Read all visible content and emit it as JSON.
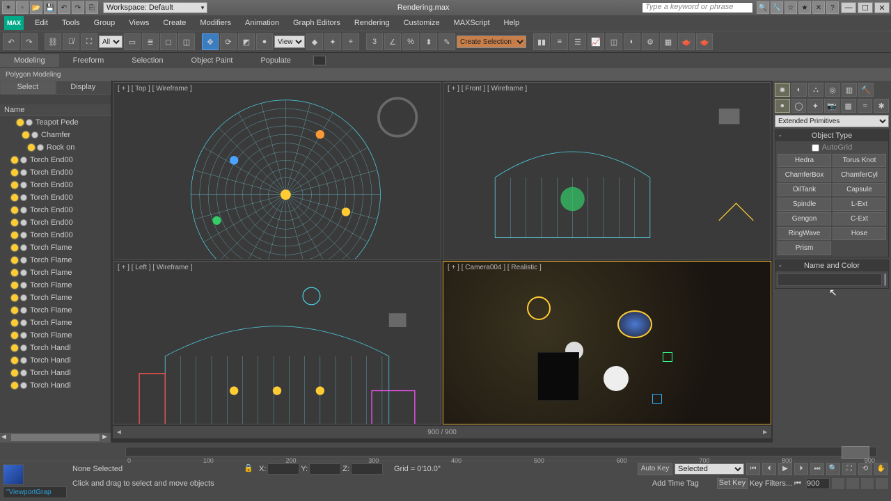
{
  "title": "Rendering.max",
  "workspace_label": "Workspace: Default",
  "search_placeholder": "Type a keyword or phrase",
  "menu": [
    "Edit",
    "Tools",
    "Group",
    "Views",
    "Create",
    "Modifiers",
    "Animation",
    "Graph Editors",
    "Rendering",
    "Customize",
    "MAXScript",
    "Help"
  ],
  "toolbar_dropdown1": "All",
  "toolbar_dropdown2": "View",
  "toolbar_dropdown3": "Create Selection Se",
  "ribbon_tabs": [
    "Modeling",
    "Freeform",
    "Selection",
    "Object Paint",
    "Populate"
  ],
  "ribbon_sub": "Polygon Modeling",
  "left_tabs": [
    "Select",
    "Display"
  ],
  "left_col": "Name",
  "scene_items": [
    "Teapot Pede",
    "Chamfer",
    "Rock on",
    "Torch End00",
    "Torch End00",
    "Torch End00",
    "Torch End00",
    "Torch End00",
    "Torch End00",
    "Torch End00",
    "Torch Flame",
    "Torch Flame",
    "Torch Flame",
    "Torch Flame",
    "Torch Flame",
    "Torch Flame",
    "Torch Flame",
    "Torch Flame",
    "Torch Handl",
    "Torch Handl",
    "Torch Handl",
    "Torch Handl"
  ],
  "viewports": {
    "top": "[ + ] [ Top ]  [ Wireframe ]",
    "front": "[ + ] [ Front ]  [ Wireframe ]",
    "left": "[ + ] [ Left ]  [ Wireframe ]",
    "cam": "[ + ] [ Camera004 ]  [ Realistic ]"
  },
  "time_display": "900 / 900",
  "timeline_ticks": [
    "0",
    "100",
    "200",
    "300",
    "400",
    "500",
    "600",
    "700",
    "800",
    "900"
  ],
  "cmd_dropdown": "Extended Primitives",
  "rollout_objtype": "Object Type",
  "autogrid_label": "AutoGrid",
  "obj_buttons": [
    "Hedra",
    "Torus Knot",
    "ChamferBox",
    "ChamferCyl",
    "OilTank",
    "Capsule",
    "Spindle",
    "L-Ext",
    "Gengon",
    "C-Ext",
    "RingWave",
    "Hose",
    "Prism"
  ],
  "rollout_name": "Name and Color",
  "status": {
    "selection": "None Selected",
    "x": "X:",
    "y": "Y:",
    "z": "Z:",
    "grid": "Grid = 0'10.0\"",
    "autokey": "Auto Key",
    "keymode": "Selected",
    "setkey": "Set Key",
    "keyfilters": "Key Filters...",
    "frame": "900"
  },
  "prompt": "Click and drag to select and move objects",
  "addtag": "Add Time Tag",
  "vpgraph": "\"ViewportGrap"
}
